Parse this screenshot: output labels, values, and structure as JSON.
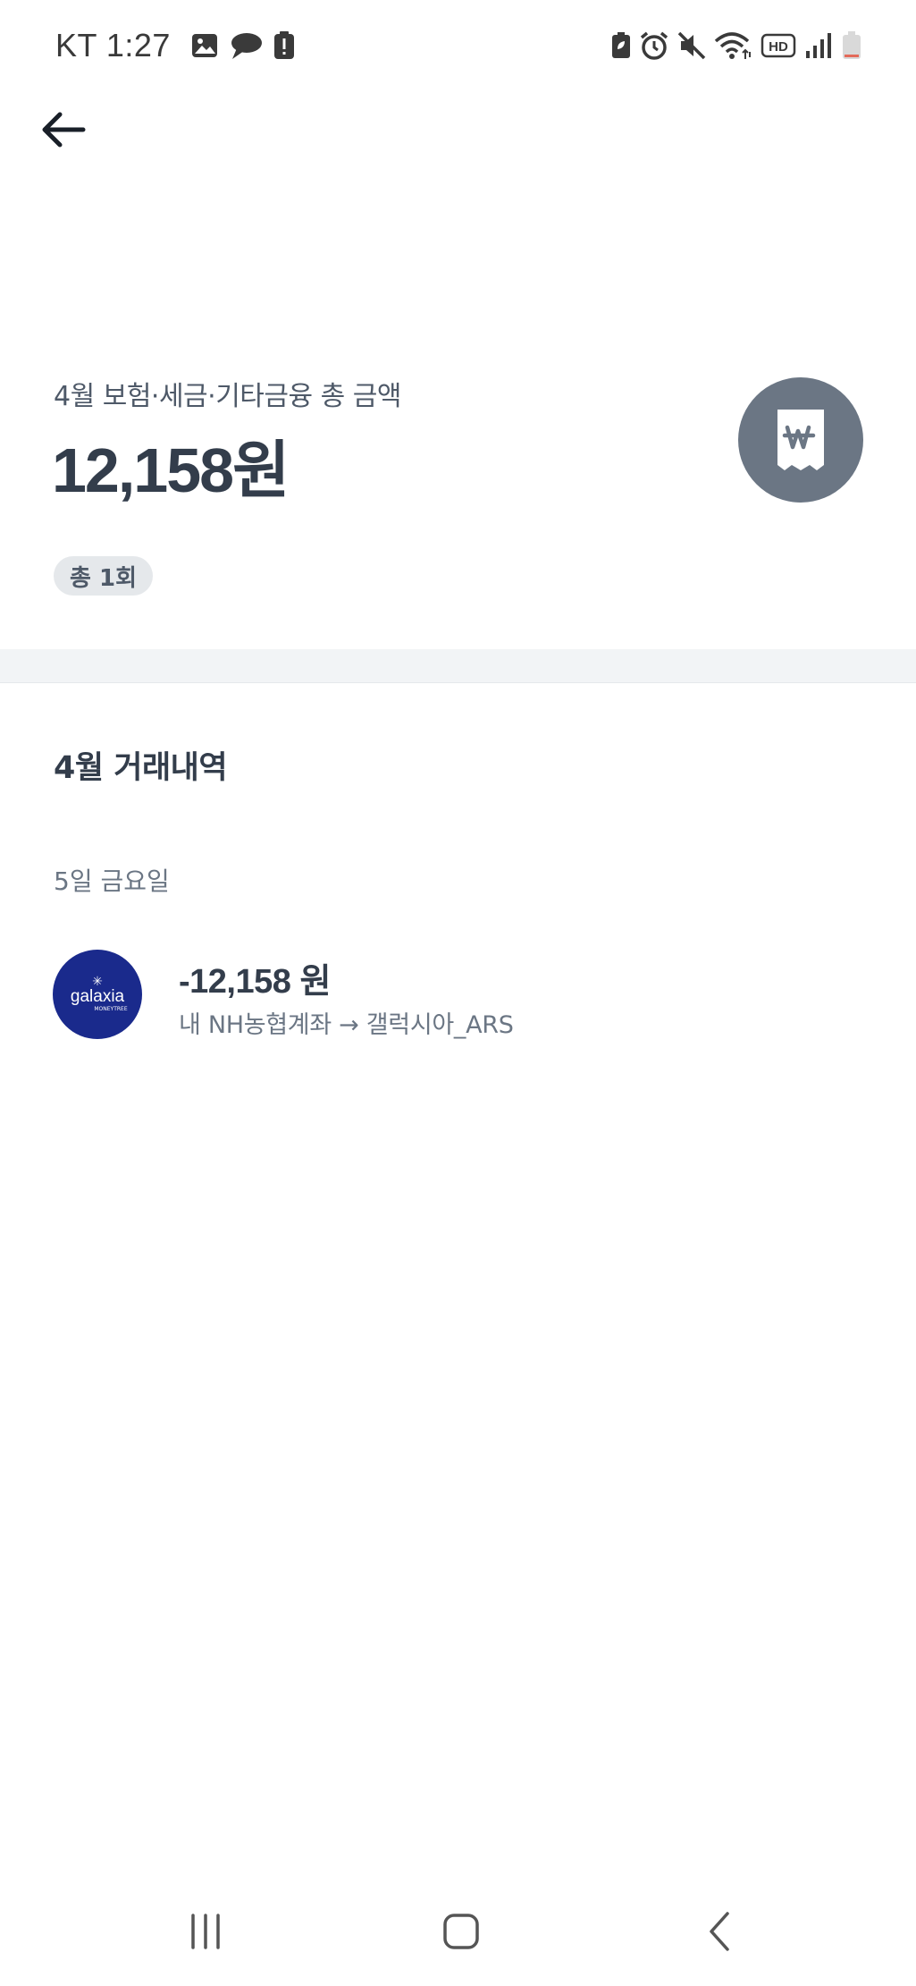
{
  "status_bar": {
    "time": "KT 1:27",
    "left_icons": [
      "gallery-icon",
      "chat-bubble-icon",
      "alert-icon"
    ],
    "right_icons": [
      "battery-saver-icon",
      "alarm-icon",
      "mute-icon",
      "wifi-icon",
      "hd-icon",
      "signal-icon",
      "battery-icon"
    ],
    "hd_label": "HD"
  },
  "header": {
    "back_icon": "arrow-left-icon"
  },
  "summary": {
    "label": "4월 보험·세금·기타금융 총 금액",
    "total": "12,158원",
    "count_badge": "총 1회",
    "icon": "receipt-won-icon",
    "icon_color": "#6b7684"
  },
  "history": {
    "title": "4월 거래내역",
    "groups": [
      {
        "date": "5일 금요일",
        "items": [
          {
            "logo_text": "galaxia",
            "logo_sub": "MONEYTREE",
            "logo_color": "#1a2a8c",
            "amount": "-12,158 원",
            "detail": "내 NH농협계좌 → 갤럭시아_ARS"
          }
        ]
      }
    ]
  },
  "nav_bar": {
    "recents": "recents-icon",
    "home": "home-icon",
    "back": "back-chevron-icon"
  }
}
